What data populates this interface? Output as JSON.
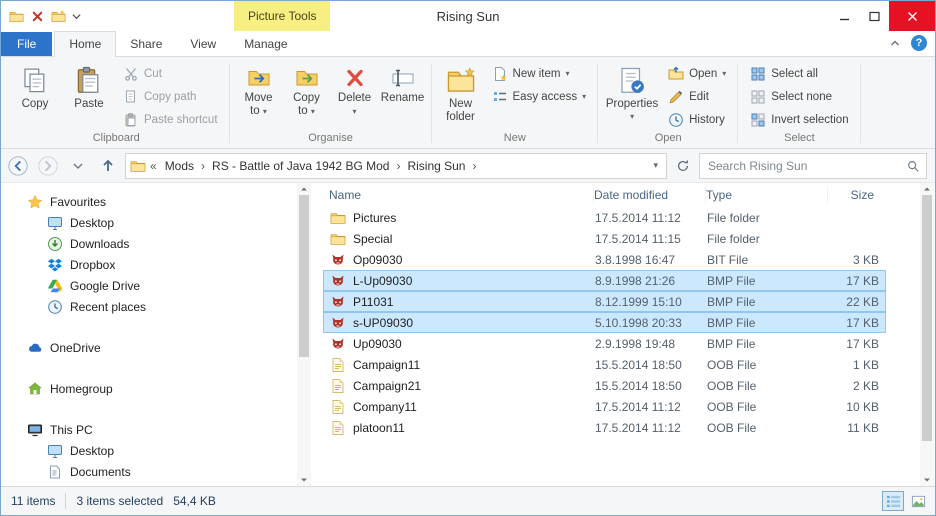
{
  "window": {
    "title": "Rising Sun",
    "context_tab": "Picture Tools"
  },
  "ui": {
    "caret": "▾",
    "overflow": "«",
    "crumb_sep": "›",
    "help": "?"
  },
  "tabs": {
    "file": "File",
    "home": "Home",
    "share": "Share",
    "view": "View",
    "manage": "Manage"
  },
  "ribbon": {
    "clipboard": {
      "label": "Clipboard",
      "copy": "Copy",
      "paste": "Paste",
      "cut": "Cut",
      "copy_path": "Copy path",
      "paste_shortcut": "Paste shortcut"
    },
    "organise": {
      "label": "Organise",
      "move_to": "Move to",
      "copy_to": "Copy to",
      "delete": "Delete",
      "rename": "Rename"
    },
    "new": {
      "label": "New",
      "new_folder": "New folder",
      "new_item": "New item",
      "easy_access": "Easy access"
    },
    "open": {
      "label": "Open",
      "properties": "Properties",
      "open": "Open",
      "edit": "Edit",
      "history": "History"
    },
    "select": {
      "label": "Select",
      "select_all": "Select all",
      "select_none": "Select none",
      "invert_selection": "Invert selection"
    }
  },
  "address": {
    "crumbs": [
      "Mods",
      "RS - Battle of Java 1942 BG Mod",
      "Rising Sun"
    ]
  },
  "search": {
    "placeholder": "Search Rising Sun"
  },
  "sidebar": {
    "items": [
      {
        "label": "Favourites",
        "icon": "star",
        "level": 0,
        "gap": false
      },
      {
        "label": "Desktop",
        "icon": "monitor",
        "level": 1,
        "gap": false
      },
      {
        "label": "Downloads",
        "icon": "download",
        "level": 1,
        "gap": false
      },
      {
        "label": "Dropbox",
        "icon": "dropbox",
        "level": 1,
        "gap": false
      },
      {
        "label": "Google Drive",
        "icon": "gdrive",
        "level": 1,
        "gap": false
      },
      {
        "label": "Recent places",
        "icon": "recent",
        "level": 1,
        "gap": false
      },
      {
        "label": "OneDrive",
        "icon": "onedrive",
        "level": 0,
        "gap": true
      },
      {
        "label": "Homegroup",
        "icon": "homegroup",
        "level": 0,
        "gap": true
      },
      {
        "label": "This PC",
        "icon": "pc",
        "level": 0,
        "gap": true
      },
      {
        "label": "Desktop",
        "icon": "monitor",
        "level": 1,
        "gap": false
      },
      {
        "label": "Documents",
        "icon": "documents",
        "level": 1,
        "gap": false
      }
    ]
  },
  "files": {
    "columns": [
      "Name",
      "Date modified",
      "Type",
      "Size"
    ],
    "rows": [
      {
        "name": "Pictures",
        "icon": "folder",
        "date": "17.5.2014 11:12",
        "type": "File folder",
        "size": "",
        "selected": false
      },
      {
        "name": "Special",
        "icon": "folder",
        "date": "17.5.2014 11:15",
        "type": "File folder",
        "size": "",
        "selected": false
      },
      {
        "name": "Op09030",
        "icon": "image",
        "date": "3.8.1998 16:47",
        "type": "BIT File",
        "size": "3 KB",
        "selected": false
      },
      {
        "name": "L-Up09030",
        "icon": "image",
        "date": "8.9.1998 21:26",
        "type": "BMP File",
        "size": "17 KB",
        "selected": true
      },
      {
        "name": "P11031",
        "icon": "image",
        "date": "8.12.1999 15:10",
        "type": "BMP File",
        "size": "22 KB",
        "selected": true
      },
      {
        "name": "s-UP09030",
        "icon": "image",
        "date": "5.10.1998 20:33",
        "type": "BMP File",
        "size": "17 KB",
        "selected": true
      },
      {
        "name": "Up09030",
        "icon": "image",
        "date": "2.9.1998 19:48",
        "type": "BMP File",
        "size": "17 KB",
        "selected": false
      },
      {
        "name": "Campaign11",
        "icon": "oob",
        "date": "15.5.2014 18:50",
        "type": "OOB File",
        "size": "1 KB",
        "selected": false
      },
      {
        "name": "Campaign21",
        "icon": "oob",
        "date": "15.5.2014 18:50",
        "type": "OOB File",
        "size": "2 KB",
        "selected": false
      },
      {
        "name": "Company11",
        "icon": "oob",
        "date": "17.5.2014 11:12",
        "type": "OOB File",
        "size": "10 KB",
        "selected": false
      },
      {
        "name": "platoon11",
        "icon": "oob",
        "date": "17.5.2014 11:12",
        "type": "OOB File",
        "size": "11 KB",
        "selected": false
      }
    ]
  },
  "status": {
    "count": "11 items",
    "selected": "3 items selected",
    "size": "54,4 KB"
  }
}
